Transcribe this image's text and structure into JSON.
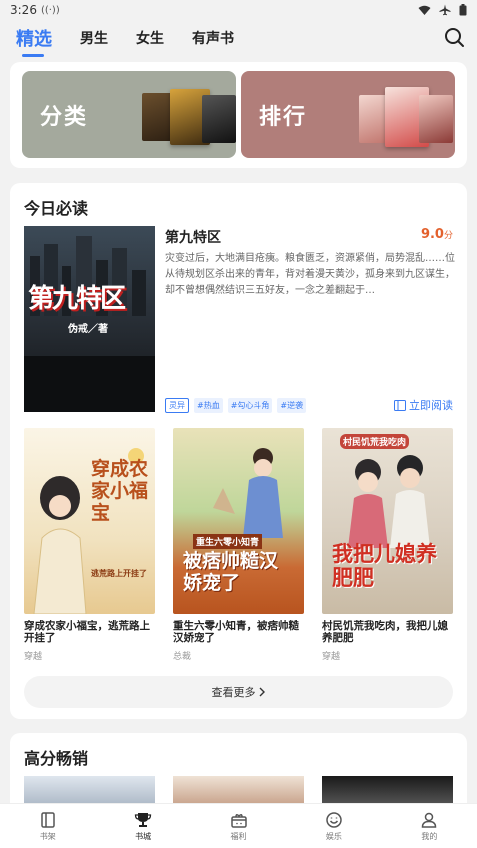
{
  "status_bar": {
    "time": "3:26"
  },
  "top_nav": {
    "tabs": [
      {
        "label": "精选"
      },
      {
        "label": "男生"
      },
      {
        "label": "女生"
      },
      {
        "label": "有声书"
      }
    ]
  },
  "banners": [
    {
      "label": "分类"
    },
    {
      "label": "排行"
    }
  ],
  "today": {
    "title": "今日必读",
    "hero": {
      "title": "第九特区",
      "score": "9.0",
      "score_unit": "分",
      "description": "灾变过后，大地满目疮痍。粮食匮乏，资源紧俏，局势混乱……位从待规划区杀出来的青年，背对着漫天黄沙，孤身来到九区谋生，却不曾想偶然结识三五好友，一念之差翻起于…",
      "cover_title": "第九特区",
      "cover_author": "伪戒／著",
      "tags": [
        "灵异",
        "#热血",
        "#勾心斗角",
        "#逆袭"
      ],
      "read_label": "立即阅读"
    },
    "books": [
      {
        "name": "穿成农家小福宝，逃荒路上开挂了",
        "genre": "穿越",
        "cover_title": "穿成农家小福宝",
        "cover_sub": "逃荒路上开挂了"
      },
      {
        "name": "重生六零小知青，被痞帅糙汉娇宠了",
        "genre": "总裁",
        "cover_title": "被痞帅糙汉娇宠了",
        "cover_sub": "重生六零小知青"
      },
      {
        "name": "村民饥荒我吃肉，我把儿媳养肥肥",
        "genre": "穿越",
        "cover_title": "我把儿媳养肥肥",
        "cover_sub": "村民饥荒我吃肉"
      }
    ],
    "more_label": "查看更多"
  },
  "bestseller": {
    "title": "高分畅销"
  },
  "bottom_nav": [
    {
      "label": "书架",
      "icon": "bookshelf-icon"
    },
    {
      "label": "书城",
      "icon": "trophy-icon"
    },
    {
      "label": "福利",
      "icon": "gift-icon"
    },
    {
      "label": "娱乐",
      "icon": "smile-icon"
    },
    {
      "label": "我的",
      "icon": "user-icon"
    }
  ],
  "colors": {
    "accent": "#3a7bf3",
    "score": "#e3612d"
  }
}
